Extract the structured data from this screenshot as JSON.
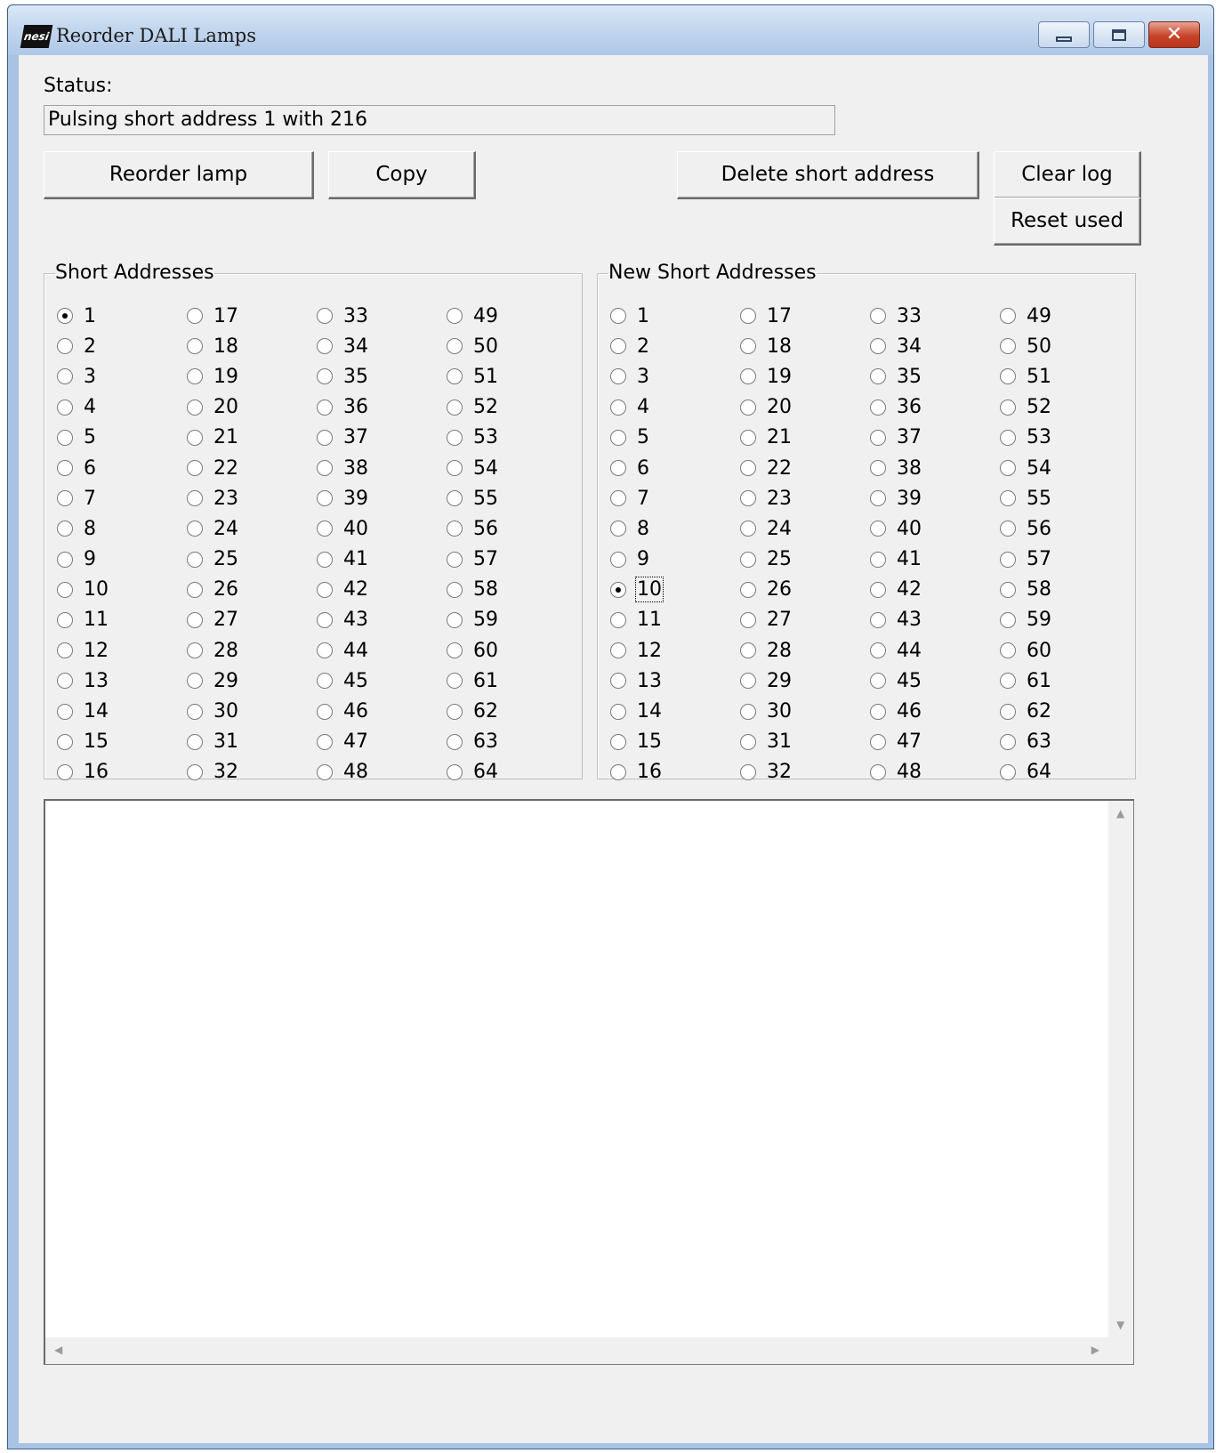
{
  "window": {
    "title": "Reorder DALI Lamps",
    "icon_text": "nesi"
  },
  "status": {
    "label": "Status:",
    "value": "Pulsing short address 1 with 216"
  },
  "buttons": {
    "reorder": "Reorder lamp",
    "copy": "Copy",
    "delete": "Delete short address",
    "clear_log": "Clear log",
    "reset_used": "Reset used"
  },
  "short_addresses": {
    "title": "Short Addresses",
    "selected": "1"
  },
  "new_short_addresses": {
    "title": "New Short Addresses",
    "selected": "10"
  },
  "log": {
    "lines": []
  }
}
